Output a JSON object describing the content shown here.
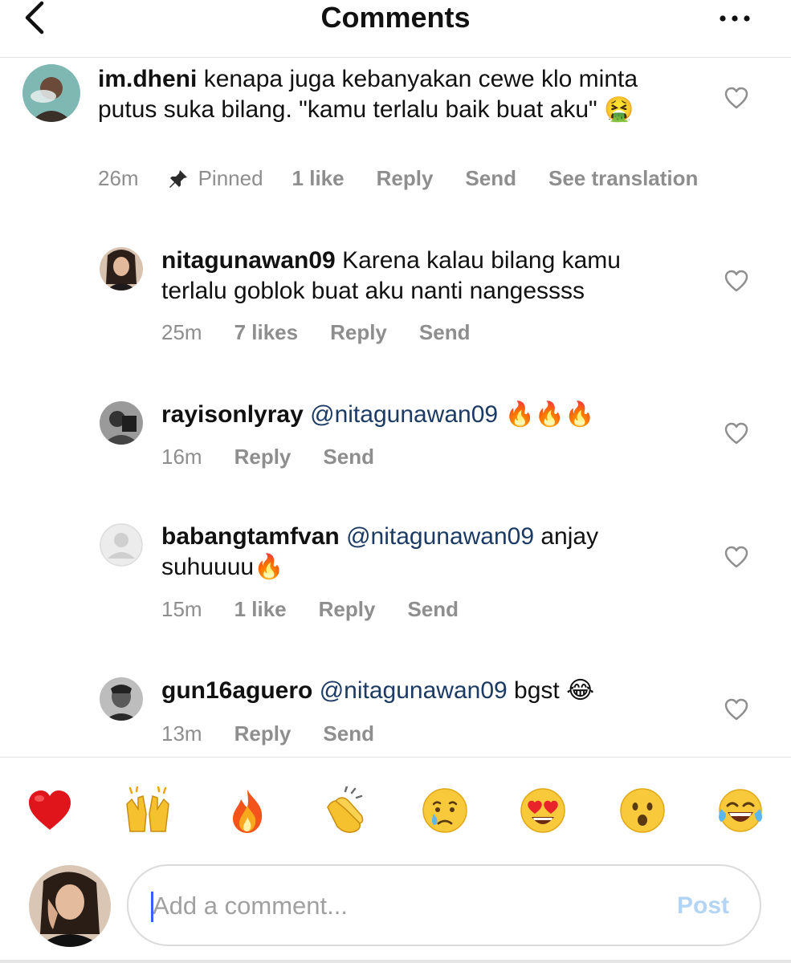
{
  "header": {
    "title": "Comments",
    "back_icon": "chevron-left-icon",
    "more_icon": "more-horizontal-icon"
  },
  "comments": [
    {
      "username": "im.dheni",
      "mention": "",
      "text": "kenapa juga kebanyakan cewe klo minta putus suka bilang. \"kamu terlalu baik buat aku\" 🤮",
      "time": "26m",
      "pinned": "Pinned",
      "likes": "1 like",
      "reply": "Reply",
      "send": "Send",
      "translate": "See translation"
    },
    {
      "username": "nitagunawan09",
      "text": "Karena kalau bilang kamu terlalu goblok buat aku nanti nangessss",
      "time": "25m",
      "likes": "7 likes",
      "reply": "Reply",
      "send": "Send"
    },
    {
      "username": "rayisonlyray",
      "mention": "@nitagunawan09",
      "text": "🔥🔥🔥",
      "time": "16m",
      "reply": "Reply",
      "send": "Send"
    },
    {
      "username": "babangtamfvan",
      "mention": "@nitagunawan09",
      "text": "anjay suhuuuu🔥",
      "time": "15m",
      "likes": "1 like",
      "reply": "Reply",
      "send": "Send"
    },
    {
      "username": "gun16aguero",
      "mention": "@nitagunawan09",
      "text": "bgst 😂",
      "time": "13m",
      "reply": "Reply",
      "send": "Send"
    }
  ],
  "reactions": [
    "❤️",
    "🙌",
    "🔥",
    "👏",
    "😢",
    "😍",
    "😮",
    "😂"
  ],
  "composer": {
    "placeholder": "Add a comment...",
    "post_label": "Post"
  },
  "colors": {
    "meta": "#8e8e8e",
    "mention": "#1b3a64",
    "post": "#b3d4f5",
    "divider": "#e3e3e3"
  }
}
